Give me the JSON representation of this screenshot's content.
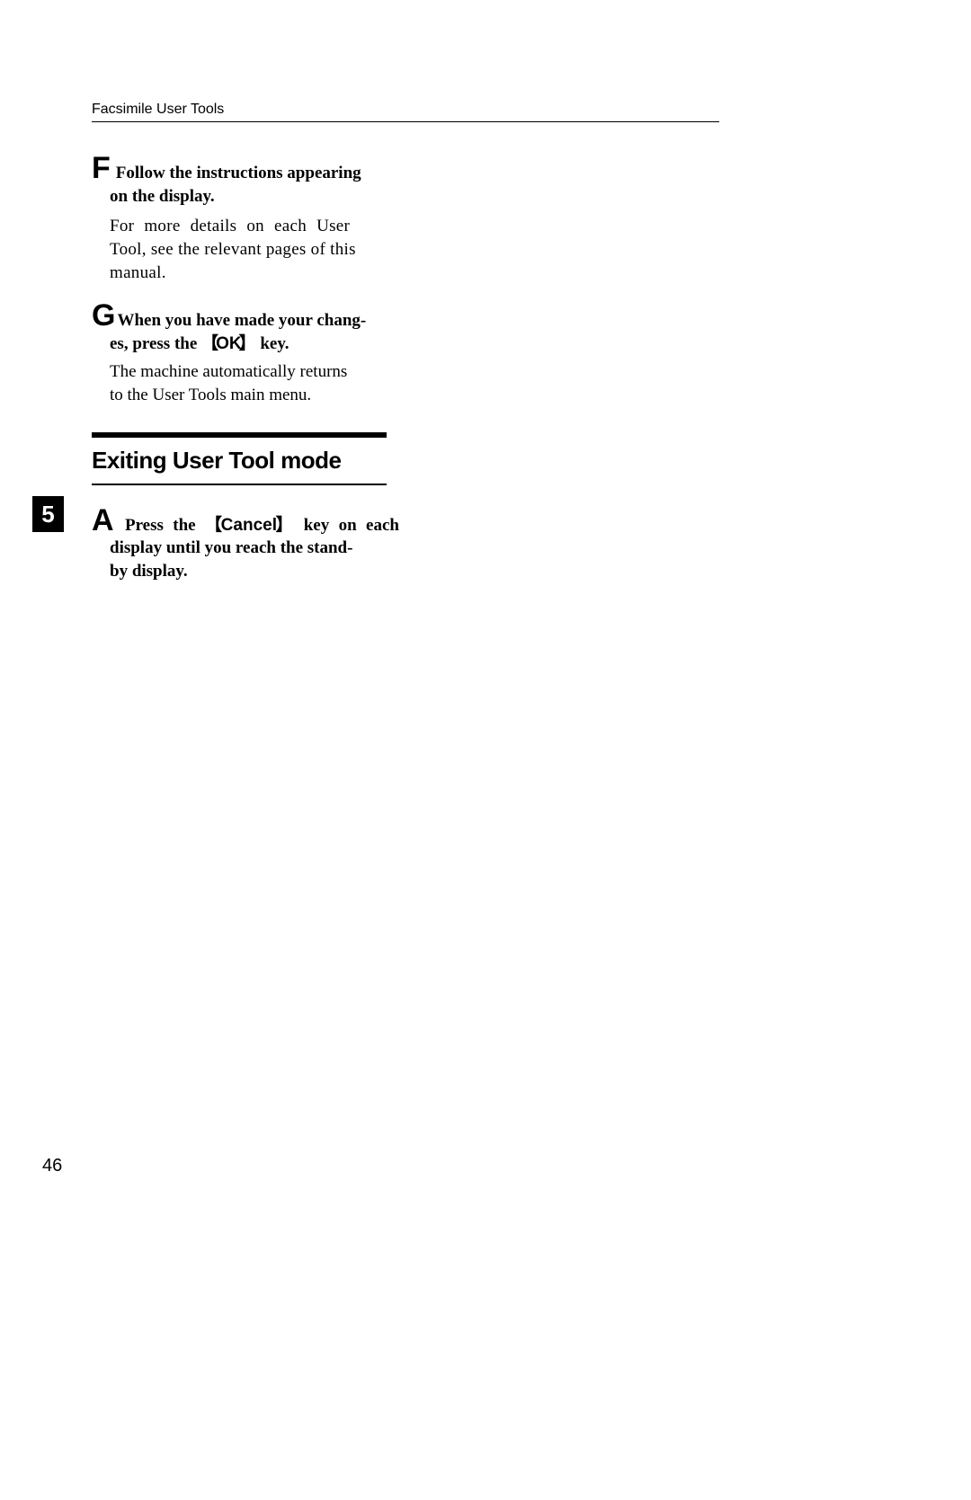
{
  "header": "Facsimile User Tools",
  "steps": {
    "f": {
      "letter": "F",
      "heading_l1": "Follow the instructions appearing",
      "heading_l2": "on the display.",
      "body_l1": "For more details on each User",
      "body_l2": "Tool, see the relevant pages of this",
      "body_l3": "manual."
    },
    "g": {
      "letter": "G",
      "heading_l1": "When you have made your chang-",
      "heading_l2_pre": "es, press the ",
      "heading_key": "OK",
      "heading_l2_post": " key.",
      "body_l1": "The machine automatically returns",
      "body_l2": "to the User Tools main menu."
    },
    "a": {
      "letter": "A",
      "heading_pre": "Press the ",
      "heading_key": "Cancel",
      "heading_post": " key on each",
      "heading_l2": "display until you reach the stand-",
      "heading_l3": "by display."
    }
  },
  "section_title": "Exiting User Tool mode",
  "chapter": "5",
  "page_number": "46"
}
